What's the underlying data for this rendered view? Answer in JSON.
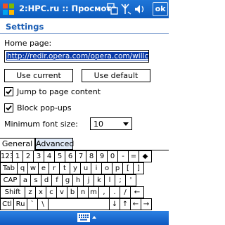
{
  "titlebar": {
    "title": "2:HPC.ru :: Просмотр",
    "ok_label": "ok",
    "icons": [
      "start-icon",
      "sync-icon",
      "signal-icon",
      "volume-icon"
    ]
  },
  "settings": {
    "heading": "Settings",
    "home_page_label": "Home page:",
    "home_page_url": "http://redir.opera.com/opera.com/willcom/",
    "use_current_label": "Use current",
    "use_default_label": "Use default",
    "jump_label": "Jump to page content",
    "jump_checked": true,
    "block_label": "Block pop-ups",
    "block_checked": true,
    "min_font_label": "Minimum font size:",
    "min_font_value": "10"
  },
  "tabs": [
    {
      "label": "General",
      "active": true
    },
    {
      "label": "Advanced",
      "active": false
    }
  ],
  "keyboard": {
    "row1": [
      "123",
      "1",
      "2",
      "3",
      "4",
      "5",
      "6",
      "7",
      "8",
      "9",
      "0",
      "-",
      "=",
      "◆"
    ],
    "row2": [
      "Tab",
      "q",
      "w",
      "e",
      "r",
      "t",
      "y",
      "u",
      "i",
      "o",
      "p",
      "[",
      "]"
    ],
    "row3": [
      "CAP",
      "a",
      "s",
      "d",
      "f",
      "g",
      "h",
      "j",
      "k",
      "l",
      ";",
      "'"
    ],
    "row4": [
      "Shift",
      "z",
      "x",
      "c",
      "v",
      "b",
      "n",
      "m",
      ",",
      ".",
      "/",
      "←"
    ],
    "row5": [
      "Ctl",
      "Ru",
      "`",
      "\\",
      "",
      "↓",
      "↑",
      "←",
      "→"
    ]
  },
  "colors": {
    "titlebar": "#0d5bbd",
    "heading": "#1a5db4",
    "selection": "#0a3aa8"
  }
}
